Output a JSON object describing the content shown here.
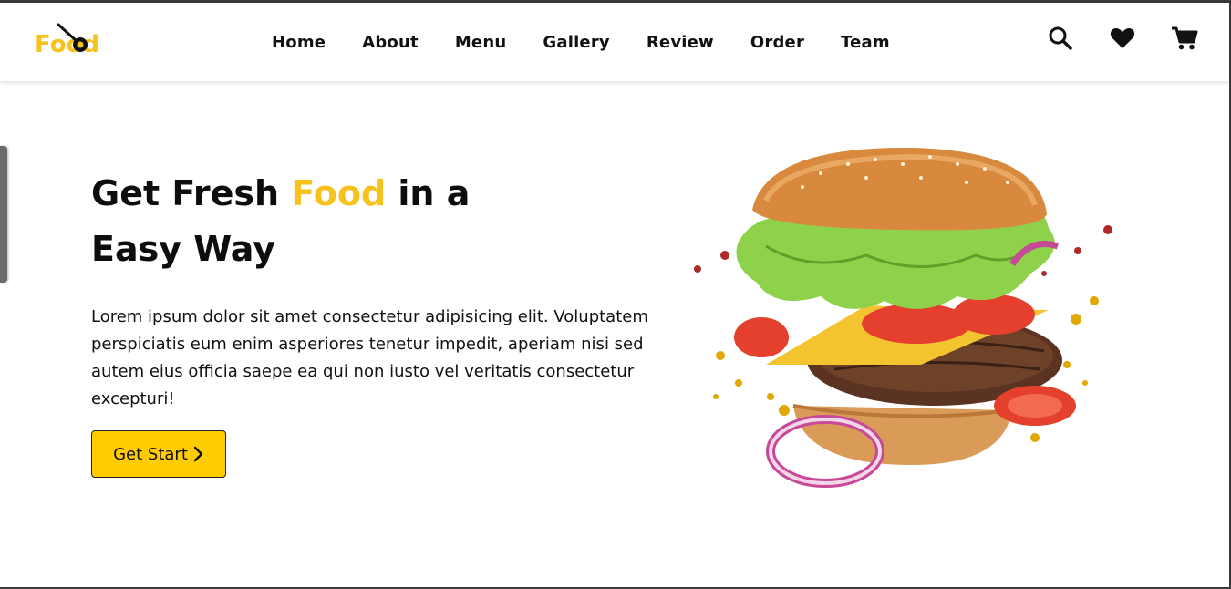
{
  "brand": {
    "logo_text": "Food"
  },
  "nav": {
    "items": [
      "Home",
      "About",
      "Menu",
      "Gallery",
      "Review",
      "Order",
      "Team"
    ]
  },
  "header_icons": [
    "search-icon",
    "heart-icon",
    "cart-icon"
  ],
  "hero": {
    "title_part1": "Get Fresh ",
    "title_accent": "Food",
    "title_part2": " in a",
    "title_line2": "Easy Way",
    "paragraph": "Lorem ipsum dolor sit amet consectetur adipisicing elit. Voluptatem perspiciatis eum enim asperiores tenetur impedit, aperiam nisi sed autem eius officia saepe ea qui non iusto vel veritatis consectetur excepturi!",
    "button_label": "Get Start",
    "button_icon": "chevron-right-icon"
  },
  "colors": {
    "accent": "#f7c21d",
    "button": "#ffcc00",
    "text": "#111111"
  }
}
